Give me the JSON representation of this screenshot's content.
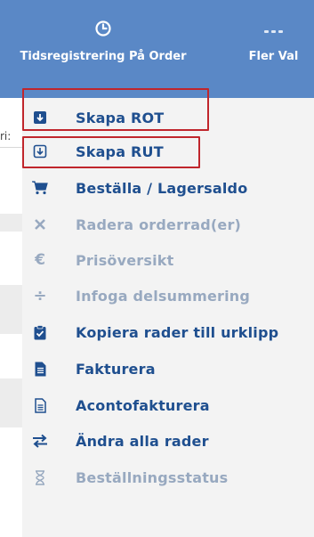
{
  "toolbar": {
    "time_label": "Tidsregistrering På Order",
    "time_icon": "clock-icon",
    "more_label": "Fler Val",
    "more_icon": "more-dots-icon"
  },
  "background": {
    "clipped_text": "ri:"
  },
  "menu": {
    "items": [
      {
        "label": "Skapa ROT",
        "icon": "download-box-icon",
        "enabled": true
      },
      {
        "label": "Skapa RUT",
        "icon": "download-box-outline-icon",
        "enabled": true
      },
      {
        "label": "Beställa / Lagersaldo",
        "icon": "cart-icon",
        "enabled": true
      },
      {
        "label": "Radera orderrad(er)",
        "icon": "x-icon",
        "enabled": false
      },
      {
        "label": "Prisöversikt",
        "icon": "euro-icon",
        "enabled": false
      },
      {
        "label": "Infoga delsummering",
        "icon": "divide-icon",
        "enabled": false
      },
      {
        "label": "Kopiera rader till urklipp",
        "icon": "clipboard-check-icon",
        "enabled": true
      },
      {
        "label": "Fakturera",
        "icon": "invoice-icon",
        "enabled": true
      },
      {
        "label": "Acontofakturera",
        "icon": "invoice-outline-icon",
        "enabled": true
      },
      {
        "label": "Ändra alla rader",
        "icon": "swap-arrows-icon",
        "enabled": true
      },
      {
        "label": "Beställningsstatus",
        "icon": "hourglass-icon",
        "enabled": false
      }
    ]
  },
  "colors": {
    "toolbar_bg": "#5a88c6",
    "menu_bg": "#f3f3f3",
    "enabled_text": "#1f4f8f",
    "disabled_text": "#98a9c0",
    "highlight": "#c0262c"
  }
}
